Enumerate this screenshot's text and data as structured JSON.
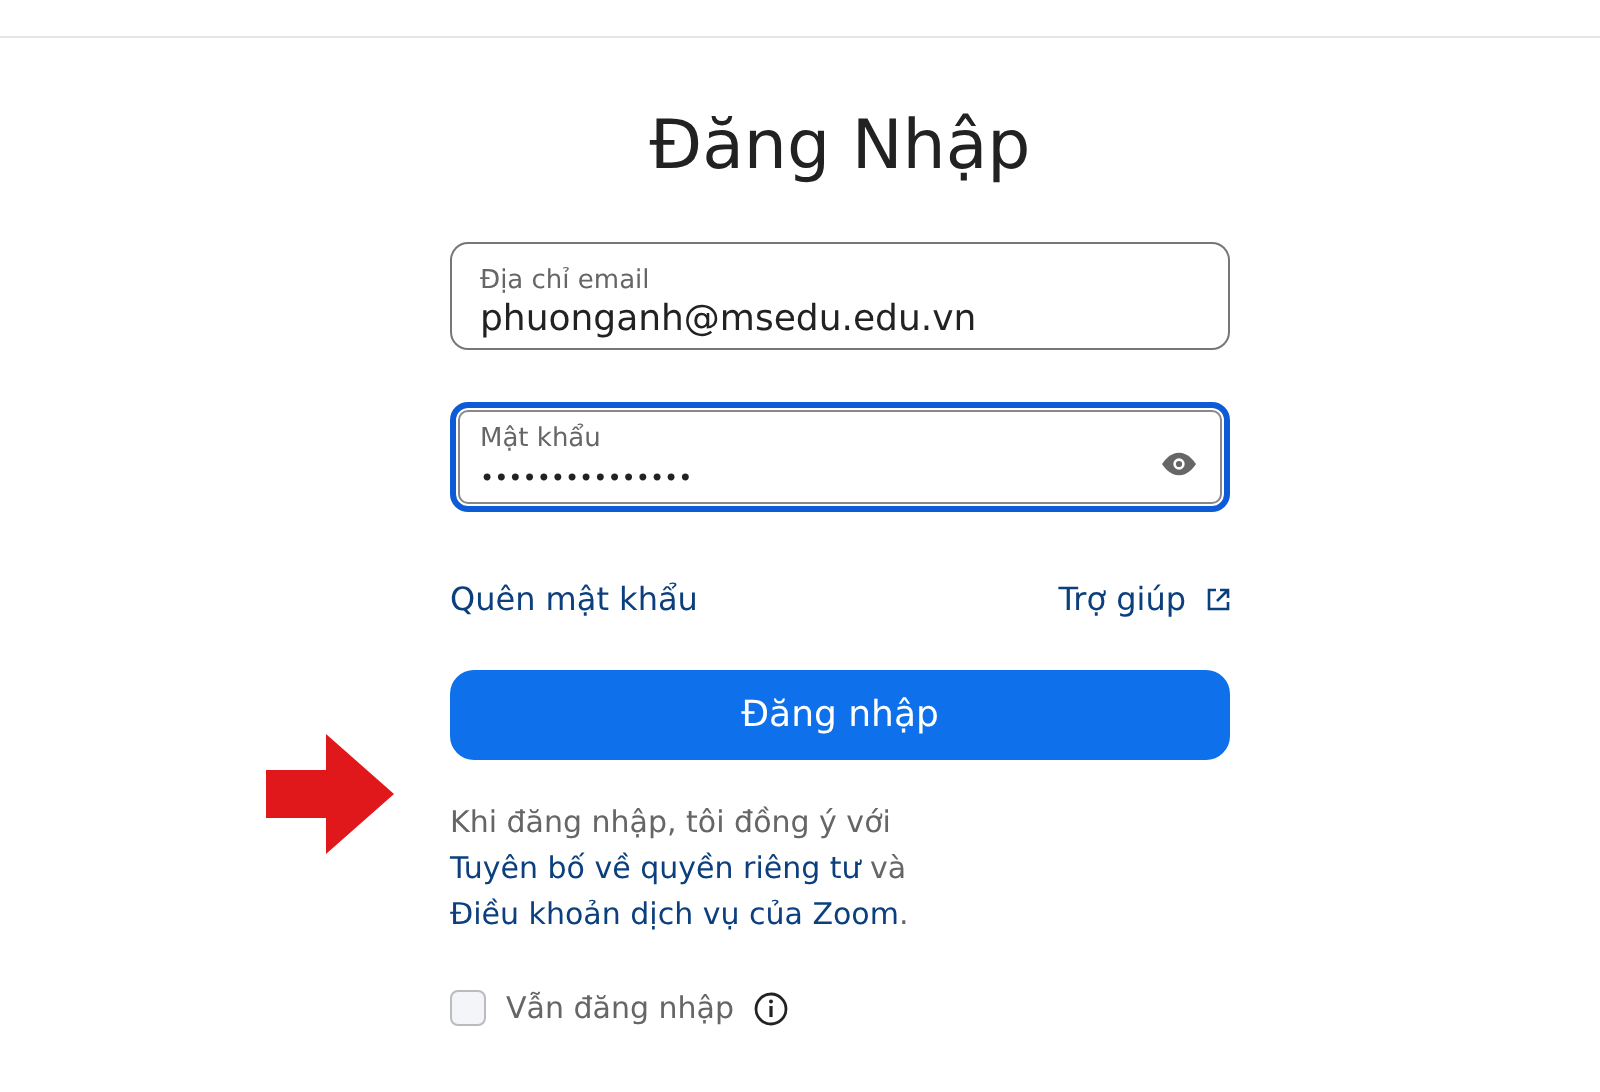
{
  "title": "Đăng Nhập",
  "fields": [
    {
      "kind": "email",
      "label": "Địa chỉ email",
      "value": "phuonganh@msedu.edu.vn",
      "focused": false
    },
    {
      "kind": "password",
      "label": "Mật khẩu",
      "value": "•••••••••••••••",
      "focused": true
    }
  ],
  "links": {
    "forgot": "Quên mật khẩu",
    "help": "Trợ giúp"
  },
  "submit": "Đăng nhập",
  "consent": [
    {
      "kind": "text",
      "text": "Khi đăng nhập, tôi đồng ý với "
    },
    {
      "kind": "link",
      "text": "Tuyên bố về quyền riêng tư"
    },
    {
      "kind": "text",
      "text": " và "
    },
    {
      "kind": "link",
      "text": "Điều khoản dịch vụ của Zoom"
    },
    {
      "kind": "text",
      "text": "."
    }
  ],
  "remember": {
    "label": "Vẫn đăng nhập",
    "checked": false
  }
}
